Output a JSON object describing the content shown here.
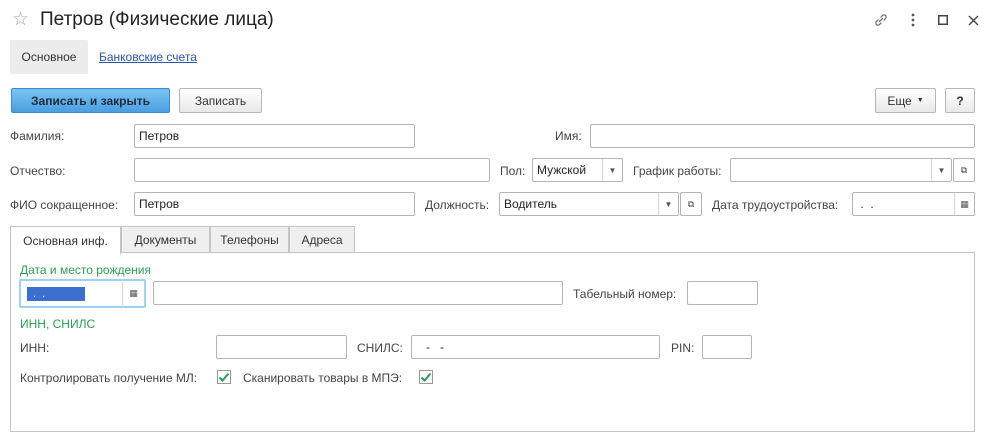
{
  "window": {
    "title": "Петров (Физические лица)"
  },
  "nav": {
    "main": "Основное",
    "bank_accounts": "Банковские счета"
  },
  "toolbar": {
    "save_close": "Записать и закрыть",
    "save": "Записать",
    "more": "Еще",
    "help": "?"
  },
  "fields": {
    "surname": {
      "label": "Фамилия:",
      "value": "Петров"
    },
    "name": {
      "label": "Имя:",
      "value": ""
    },
    "patronymic": {
      "label": "Отчество:",
      "value": ""
    },
    "gender": {
      "label": "Пол:",
      "value": "Мужской"
    },
    "schedule": {
      "label": "График работы:",
      "value": ""
    },
    "short_name": {
      "label": "ФИО сокращенное:",
      "value": "Петров"
    },
    "position": {
      "label": "Должность:",
      "value": "Водитель"
    },
    "hire_date": {
      "label": "Дата трудоустройства:",
      "value": " .  ."
    }
  },
  "tabs": [
    {
      "label": "Основная инф.",
      "active": true
    },
    {
      "label": "Документы",
      "active": false
    },
    {
      "label": "Телефоны",
      "active": false
    },
    {
      "label": "Адреса",
      "active": false
    }
  ],
  "main_tab": {
    "birth_section": "Дата и место рождения",
    "birth_date": ".  .",
    "birth_place": "",
    "tab_number": {
      "label": "Табельный номер:",
      "value": ""
    },
    "inn_section": "ИНН, СНИЛС",
    "inn": {
      "label": "ИНН:",
      "value": ""
    },
    "snils": {
      "label": "СНИЛС:",
      "value": "-   -"
    },
    "pin": {
      "label": "PIN:",
      "value": ""
    },
    "control_ml": {
      "label": "Контролировать получение МЛ:",
      "checked": true
    },
    "scan_mpe": {
      "label": "Сканировать товары в МПЭ:",
      "checked": true
    }
  },
  "colors": {
    "accent": "#4a9fe0",
    "section_green": "#2e9c55",
    "link": "#2a55a4",
    "check_green": "#2e9c55"
  }
}
